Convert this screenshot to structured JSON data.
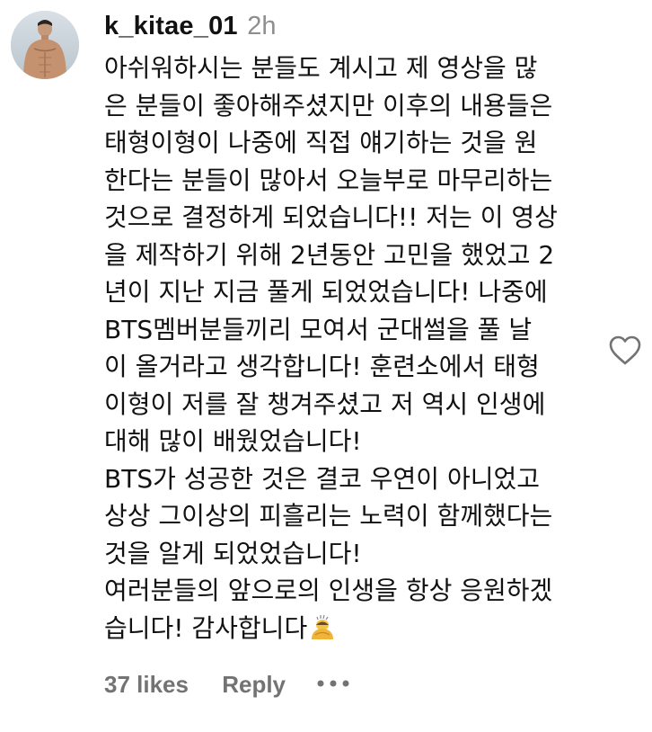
{
  "comment": {
    "username": "k_kitae_01",
    "timestamp": "2h",
    "lines": [
      "아쉬워하시는 분들도 계시고 제 영상을 많",
      "은 분들이 좋아해주셨지만 이후의 내용들은",
      "태형이형이 나중에 직접 얘기하는 것을 원",
      "한다는 분들이 많아서 오늘부로 마무리하는",
      "것으로 결정하게 되었습니다!! 저는 이 영상",
      "을 제작하기 위해 2년동안 고민을 했었고 2",
      "년이 지난 지금 풀게 되었었습니다! 나중에",
      "BTS멤버분들끼리 모여서 군대썰을 풀 날",
      "이 올거라고 생각합니다! 훈련소에서 태형",
      "이형이 저를 잘 챙겨주셨고 저 역시 인생에",
      "대해 많이 배웠었습니다!",
      "BTS가 성공한 것은 결코 우연이 아니었고",
      "상상 그이상의 피흘리는 노력이 함께했다는",
      "것을 알게 되었었습니다!",
      "여러분들의 앞으로의 인생을 항상 응원하겠",
      "습니다! 감사합니다"
    ],
    "emoji": "bowing-person-emoji",
    "likes": "37 likes",
    "reply_label": "Reply",
    "more_icon": "more-dots-icon",
    "like_icon": "heart-outline-icon"
  },
  "colors": {
    "text": "#111111",
    "secondary": "#8e8e8e",
    "footer": "#737373",
    "icon": "#737373"
  }
}
